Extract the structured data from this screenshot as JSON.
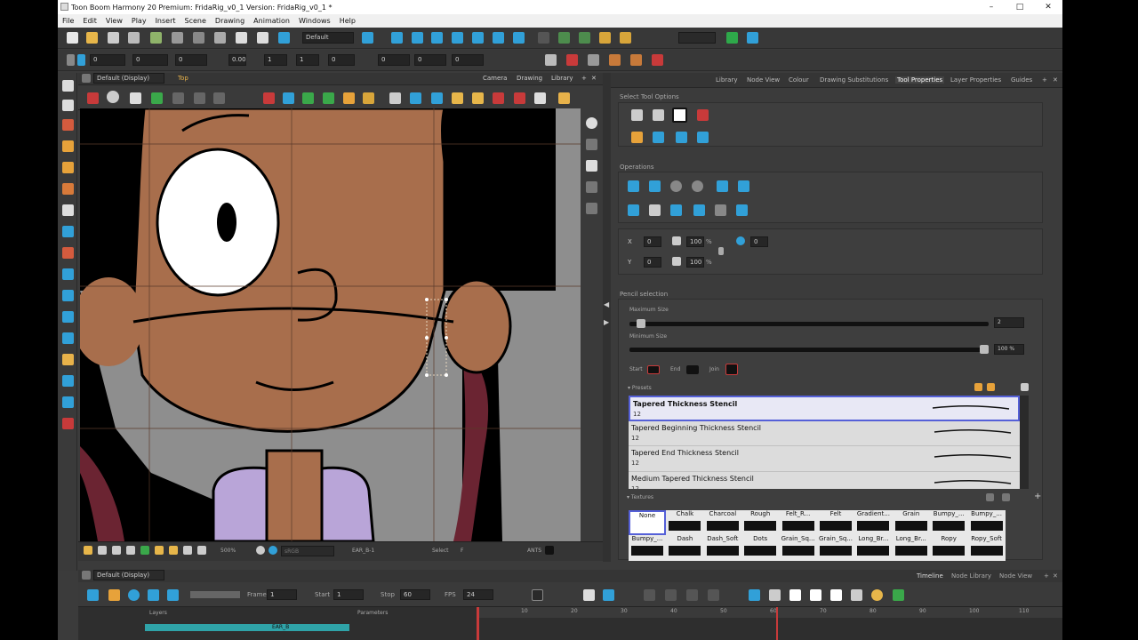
{
  "window": {
    "title": "Toon Boom Harmony 20 Premium: FridaRig_v0_1 Version: FridaRig_v0_1 *",
    "minimize": "–",
    "maximize": "□",
    "close": "✕"
  },
  "menu": [
    "File",
    "Edit",
    "View",
    "Play",
    "Insert",
    "Scene",
    "Drawing",
    "Animation",
    "Windows",
    "Help"
  ],
  "toolbar": {
    "workspace": "Default",
    "fields": [
      "0",
      "0",
      "0",
      "0.00",
      "1",
      "1",
      "0",
      "0",
      "0",
      "0"
    ]
  },
  "camera_view": {
    "view_select": "Default (Display)",
    "view_mode": "Top",
    "tabs": [
      "Camera",
      "Drawing",
      "Library"
    ],
    "bottom": {
      "zoom": "500%",
      "color_space": "sRGB",
      "node": "EAR_B-1",
      "tool": "Select",
      "flag": "F",
      "status": "ANTS"
    }
  },
  "right_panel": {
    "tabs": [
      "Library",
      "Node View",
      "Colour",
      "Drawing Substitutions",
      "Tool Properties",
      "Layer Properties",
      "Guides"
    ],
    "active_tab": "Tool Properties",
    "select_tool_options": "Select Tool Options",
    "operations": "Operations",
    "fields": {
      "x": "0",
      "y": "0",
      "w": "100",
      "h": "100",
      "pct": "%",
      "rot": "0"
    },
    "pencil_selection": "Pencil selection",
    "maximum_size": "Maximum Size",
    "maximum_size_value": "2",
    "maximum_size_fraction": 0.02,
    "minimum_size": "Minimum Size",
    "minimum_size_value": "100 %",
    "minimum_size_fraction": 1.0,
    "start": "Start",
    "end": "End",
    "join": "Join",
    "presets_label": "Presets",
    "presets": [
      {
        "name": "Tapered Thickness Stencil",
        "size": "12",
        "selected": true
      },
      {
        "name": "Tapered Beginning Thickness Stencil",
        "size": "12",
        "selected": false
      },
      {
        "name": "Tapered End Thickness Stencil",
        "size": "12",
        "selected": false
      },
      {
        "name": "Medium Tapered Thickness Stencil",
        "size": "12",
        "selected": false
      }
    ],
    "textures_label": "Textures",
    "textures_row1": [
      "None",
      "Chalk",
      "Charcoal",
      "Rough",
      "Felt_R...",
      "Felt",
      "Gradient...",
      "Grain",
      "Bumpy_...",
      "Bumpy_..."
    ],
    "textures_row2": [
      "Bumpy_...",
      "Dash",
      "Dash_Soft",
      "Dots",
      "Grain_Sq...",
      "Grain_Sq...",
      "Long_Br...",
      "Long_Br...",
      "Ropy",
      "Ropy_Soft"
    ]
  },
  "timeline": {
    "view_select": "Default (Display)",
    "tabs": [
      "Timeline",
      "Node Library",
      "Node View"
    ],
    "frame_label": "Frame",
    "frame": "1",
    "start_label": "Start",
    "start": "1",
    "stop_label": "Stop",
    "stop": "60",
    "fps_label": "FPS",
    "fps": "24",
    "layers_label": "Layers",
    "parameters_label": "Parameters",
    "layer": "EAR_B",
    "ruler": [
      "10",
      "20",
      "30",
      "40",
      "50",
      "60",
      "70",
      "80",
      "90",
      "100",
      "110"
    ]
  },
  "colors": {
    "skin": "#a86e4c",
    "hair": "#000000",
    "shirt": "#b9a5d8",
    "selection_outline": "#5560d8",
    "active_icon": "#31a0d8"
  }
}
